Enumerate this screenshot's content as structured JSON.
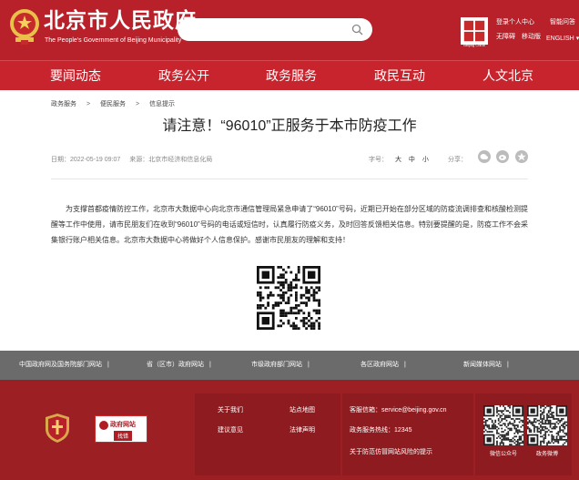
{
  "header": {
    "title": "北京市人民政府",
    "subtitle": "The People's Government of Beijing Municipality",
    "search": {
      "placeholder": ""
    },
    "beijing_logo_caption": "Beijing China",
    "top_links": {
      "login": "登录个人中心",
      "assistant": "智能问答",
      "accessible": "无障碍",
      "mobile": "移动版",
      "english": "ENGLISH"
    }
  },
  "nav": {
    "items": [
      "要闻动态",
      "政务公开",
      "政务服务",
      "政民互动",
      "人文北京"
    ]
  },
  "breadcrumb": {
    "items": [
      "政务服务",
      "便民服务",
      "信息提示"
    ],
    "separator": ">"
  },
  "article": {
    "title": "请注意！“96010”正服务于本市防疫工作",
    "date": "日期：2022-05-19 09:07",
    "source": "来源：北京市经济和信息化局",
    "font_size_label": "字号：",
    "font_size_options": [
      "大",
      "中",
      "小"
    ],
    "share_label": "分享：",
    "body": "为支撑首都疫情防控工作，北京市大数据中心向北京市通信管理局紧急申请了“96010”号码，近期已开始在部分区域的防疫流调排查和核酸检测提醒等工作中使用，请市民朋友们在收到“96010”号码的电话或短信时，认真履行防疫义务，及时回答反馈相关信息。特别要提醒的是，防疫工作不会采集银行账户相关信息。北京市大数据中心将做好个人信息保护。感谢市民朋友的理解和支持！"
  },
  "linkbar": {
    "items": [
      "中国政府网及国务院部门网站",
      "省（区市）政府网站",
      "市级政府部门网站",
      "各区政府网站",
      "新闻媒体网站"
    ],
    "separator": "|"
  },
  "footer": {
    "jiucuo_top": "政府网站",
    "jiucuo_bottom": "找错",
    "links": {
      "about": "关于我们",
      "sitemap": "站点地图",
      "feedback": "建议意见",
      "legal": "法律声明"
    },
    "contact": {
      "email": "客服信箱：service@beijing.gov.cn",
      "hotline": "政务服务热线：12345",
      "security": "关于防范仿冒网站风险的提示"
    },
    "qr_captions": [
      "微信公众号",
      "政务微博"
    ]
  }
}
